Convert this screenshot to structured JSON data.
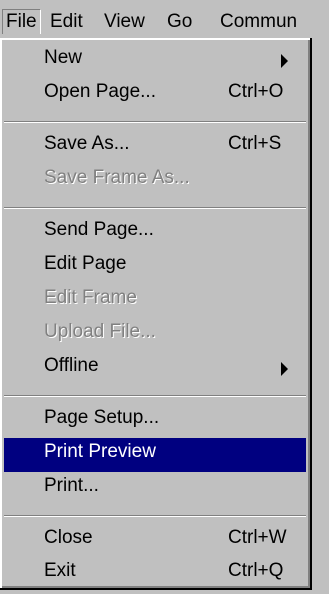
{
  "menubar": {
    "file": "File",
    "edit": "Edit",
    "view": "View",
    "go": "Go",
    "communicator": "Commun"
  },
  "menu": {
    "new": "New",
    "open_page": "Open Page...",
    "open_page_shortcut": "Ctrl+O",
    "save_as": "Save As...",
    "save_as_shortcut": "Ctrl+S",
    "save_frame_as": "Save Frame As...",
    "send_page": "Send Page...",
    "edit_page": "Edit Page",
    "edit_frame": "Edit Frame",
    "upload_file": "Upload File...",
    "offline": "Offline",
    "page_setup": "Page Setup...",
    "print_preview": "Print Preview",
    "print": "Print...",
    "close": "Close",
    "close_shortcut": "Ctrl+W",
    "exit": "Exit",
    "exit_shortcut": "Ctrl+Q"
  },
  "colors": {
    "menu_bg": "#c0c0c0",
    "highlight": "#000080",
    "disabled_text": "#808080"
  }
}
